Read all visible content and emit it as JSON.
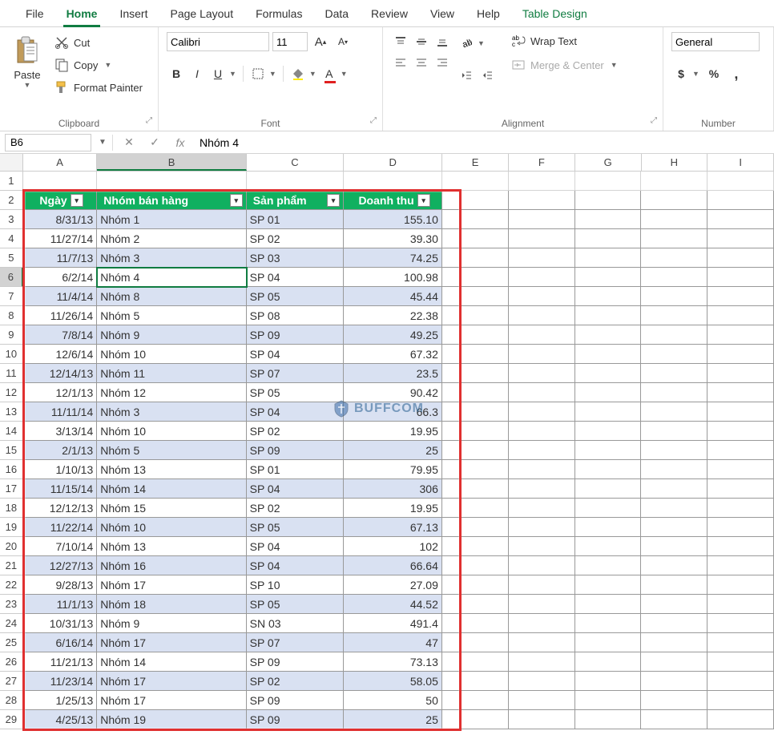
{
  "menu": {
    "tabs": [
      "File",
      "Home",
      "Insert",
      "Page Layout",
      "Formulas",
      "Data",
      "Review",
      "View",
      "Help",
      "Table Design"
    ],
    "active": "Home"
  },
  "ribbon": {
    "clipboard": {
      "label": "Clipboard",
      "paste": "Paste",
      "cut": "Cut",
      "copy": "Copy",
      "painter": "Format Painter"
    },
    "font": {
      "label": "Font",
      "name": "Calibri",
      "size": "11",
      "increase": "A",
      "decrease": "A"
    },
    "alignment": {
      "label": "Alignment",
      "wrap": "Wrap Text",
      "merge": "Merge & Center"
    },
    "number": {
      "label": "Number",
      "format": "General",
      "currency": "$",
      "percent": "%",
      "comma": ","
    }
  },
  "formulaBar": {
    "nameBox": "B6",
    "value": "Nhóm 4"
  },
  "columns": [
    "A",
    "B",
    "C",
    "D",
    "E",
    "F",
    "G",
    "H",
    "I"
  ],
  "headers": {
    "A": "Ngày",
    "B": "Nhóm bán hàng",
    "C": "Sản phẩm",
    "D": "Doanh thu"
  },
  "tableRows": [
    {
      "n": 3,
      "A": "8/31/13",
      "B": "Nhóm 1",
      "C": "SP 01",
      "D": "155.10"
    },
    {
      "n": 4,
      "A": "11/27/14",
      "B": "Nhóm 2",
      "C": "SP 02",
      "D": "39.30"
    },
    {
      "n": 5,
      "A": "11/7/13",
      "B": "Nhóm 3",
      "C": "SP 03",
      "D": "74.25"
    },
    {
      "n": 6,
      "A": "6/2/14",
      "B": "Nhóm 4",
      "C": "SP 04",
      "D": "100.98"
    },
    {
      "n": 7,
      "A": "11/4/14",
      "B": "Nhóm 8",
      "C": "SP 05",
      "D": "45.44"
    },
    {
      "n": 8,
      "A": "11/26/14",
      "B": "Nhóm 5",
      "C": "SP 08",
      "D": "22.38"
    },
    {
      "n": 9,
      "A": "7/8/14",
      "B": "Nhóm 9",
      "C": "SP 09",
      "D": "49.25"
    },
    {
      "n": 10,
      "A": "12/6/14",
      "B": "Nhóm 10",
      "C": "SP 04",
      "D": "67.32"
    },
    {
      "n": 11,
      "A": "12/14/13",
      "B": "Nhóm 11",
      "C": "SP 07",
      "D": "23.5"
    },
    {
      "n": 12,
      "A": "12/1/13",
      "B": "Nhóm 12",
      "C": "SP 05",
      "D": "90.42"
    },
    {
      "n": 13,
      "A": "11/11/14",
      "B": "Nhóm 3",
      "C": "SP 04",
      "D": "66.3"
    },
    {
      "n": 14,
      "A": "3/13/14",
      "B": "Nhóm 10",
      "C": "SP 02",
      "D": "19.95"
    },
    {
      "n": 15,
      "A": "2/1/13",
      "B": "Nhóm 5",
      "C": "SP 09",
      "D": "25"
    },
    {
      "n": 16,
      "A": "1/10/13",
      "B": "Nhóm 13",
      "C": "SP 01",
      "D": "79.95"
    },
    {
      "n": 17,
      "A": "11/15/14",
      "B": "Nhóm 14",
      "C": "SP 04",
      "D": "306"
    },
    {
      "n": 18,
      "A": "12/12/13",
      "B": "Nhóm 15",
      "C": "SP 02",
      "D": "19.95"
    },
    {
      "n": 19,
      "A": "11/22/14",
      "B": "Nhóm 10",
      "C": "SP 05",
      "D": "67.13"
    },
    {
      "n": 20,
      "A": "7/10/14",
      "B": "Nhóm 13",
      "C": "SP 04",
      "D": "102"
    },
    {
      "n": 21,
      "A": "12/27/13",
      "B": "Nhóm 16",
      "C": "SP 04",
      "D": "66.64"
    },
    {
      "n": 22,
      "A": "9/28/13",
      "B": "Nhóm 17",
      "C": "SP 10",
      "D": "27.09"
    },
    {
      "n": 23,
      "A": "11/1/13",
      "B": "Nhóm 18",
      "C": "SP 05",
      "D": "44.52"
    },
    {
      "n": 24,
      "A": "10/31/13",
      "B": "Nhóm 9",
      "C": "SN 03",
      "D": "491.4"
    },
    {
      "n": 25,
      "A": "6/16/14",
      "B": "Nhóm 17",
      "C": "SP 07",
      "D": "47"
    },
    {
      "n": 26,
      "A": "11/21/13",
      "B": "Nhóm 14",
      "C": "SP 09",
      "D": "73.13"
    },
    {
      "n": 27,
      "A": "11/23/14",
      "B": "Nhóm 17",
      "C": "SP 02",
      "D": "58.05"
    },
    {
      "n": 28,
      "A": "1/25/13",
      "B": "Nhóm 17",
      "C": "SP 09",
      "D": "50"
    },
    {
      "n": 29,
      "A": "4/25/13",
      "B": "Nhóm 19",
      "C": "SP 09",
      "D": "25"
    }
  ],
  "watermark": "BUFFCOM",
  "activeCell": {
    "row": 6,
    "col": "B"
  },
  "colWidths": {
    "A": 96,
    "B": 194,
    "C": 126,
    "D": 128,
    "E": 86,
    "F": 86,
    "G": 86,
    "H": 86,
    "I": 86
  }
}
